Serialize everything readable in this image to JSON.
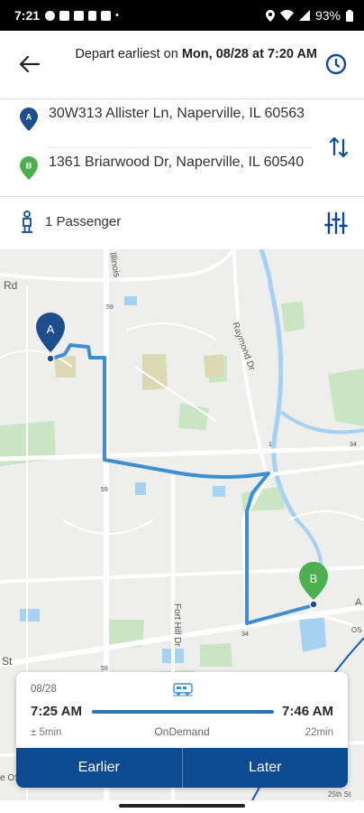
{
  "status_bar": {
    "time": "7:21",
    "battery": "93%"
  },
  "header": {
    "depart_prefix": "Depart earliest on ",
    "depart_datetime": "Mon, 08/28 at 7:20 AM",
    "accent_color": "#0d4a8f"
  },
  "locations": {
    "origin": {
      "marker": "A",
      "address": "30W313 Allister Ln, Naperville, IL 60563"
    },
    "destination": {
      "marker": "B",
      "address": "1361 Briarwood Dr, Naperville, IL 60540"
    }
  },
  "passengers": {
    "label": "1 Passenger"
  },
  "map": {
    "marker_a": "A",
    "marker_b": "B",
    "marker_a_color": "#1e4d8c",
    "marker_b_color": "#4caf50",
    "route_color": "#3d8fd1",
    "labels": {
      "rd": "Rd",
      "route_59_top": "59",
      "route_59_mid": "59",
      "route_59_bot": "59",
      "illinois": "Illinois",
      "raymond": "Raymond Dr",
      "route_1": "1",
      "route_34_right": "34",
      "route_34_bot": "34",
      "fort_hill": "Fort Hill Dr",
      "st": "St",
      "a_right": "A",
      "os_right": "OS",
      "os_left": "e OS",
      "w25": "25th St"
    }
  },
  "trip_card": {
    "date": "08/28",
    "mode_icon": "shuttle-icon",
    "depart_time": "7:25 AM",
    "arrive_time": "7:46 AM",
    "tolerance": "± 5min",
    "mode": "OnDemand",
    "duration": "22min",
    "earlier_label": "Earlier",
    "later_label": "Later"
  }
}
